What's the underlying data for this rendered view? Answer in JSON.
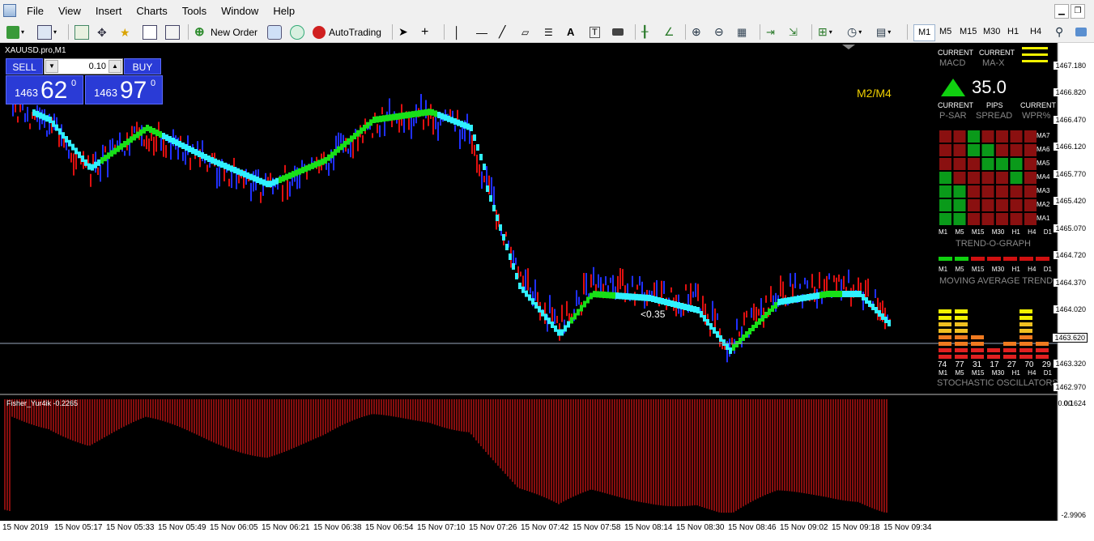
{
  "menu": [
    "File",
    "View",
    "Insert",
    "Charts",
    "Tools",
    "Window",
    "Help"
  ],
  "toolbar": {
    "new_order": "New Order",
    "autotrading": "AutoTrading"
  },
  "timeframes": [
    "M1",
    "M5",
    "M15",
    "M30",
    "H1",
    "H4"
  ],
  "active_timeframe": "M1",
  "chart": {
    "symbol_title": "XAUUSD.pro,M1",
    "sell_label": "SELL",
    "buy_label": "BUY",
    "lot": "0.10",
    "sell_price_small": "1463",
    "sell_price_big": "62",
    "sell_price_sup": "0",
    "buy_price_small": "1463",
    "buy_price_big": "97",
    "buy_price_sup": "0",
    "annotation_m2m4": "M2/M4",
    "annotation_mid": "<0.35",
    "current_price": "1463.620"
  },
  "dashboard": {
    "current1": "CURRENT",
    "macd": "MACD",
    "current2": "CURRENT",
    "mx": "MA-X",
    "pips_value": "35.0",
    "current3": "CURRENT",
    "psar": "P-SAR",
    "pips": "PIPS",
    "spread": "SPREAD",
    "current4": "CURRENT",
    "wpr": "WPR%",
    "trend_graph": "TREND-O-GRAPH",
    "ma_rows": [
      "MA7",
      "MA6",
      "MA5",
      "MA4",
      "MA3",
      "MA2",
      "MA1"
    ],
    "tf_small": [
      "M1",
      "M5",
      "M15",
      "M30",
      "H1",
      "H4",
      "D1"
    ],
    "moving_avg_trend": "MOVING AVERAGE TREND",
    "stoch_values": [
      "74",
      "77",
      "31",
      "17",
      "27",
      "70",
      "29"
    ],
    "stoch_label": "STOCHASTIC OSCILLATORS"
  },
  "price_axis": [
    "1467.180",
    "1466.820",
    "1466.470",
    "1466.120",
    "1465.770",
    "1465.420",
    "1465.070",
    "1464.720",
    "1464.370",
    "1464.020",
    "1463.620",
    "1463.320",
    "1462.970"
  ],
  "indicator": {
    "title": "Fisher_Yur4ik -0.2265",
    "top_value": "0.1624",
    "zero": "0.00",
    "bottom_value": "-2.9906"
  },
  "time_axis": [
    "15 Nov 2019",
    "15 Nov 05:17",
    "15 Nov 05:33",
    "15 Nov 05:49",
    "15 Nov 06:05",
    "15 Nov 06:21",
    "15 Nov 06:38",
    "15 Nov 06:54",
    "15 Nov 07:10",
    "15 Nov 07:26",
    "15 Nov 07:42",
    "15 Nov 07:58",
    "15 Nov 08:14",
    "15 Nov 08:30",
    "15 Nov 08:46",
    "15 Nov 09:02",
    "15 Nov 09:18",
    "15 Nov 09:34"
  ]
}
